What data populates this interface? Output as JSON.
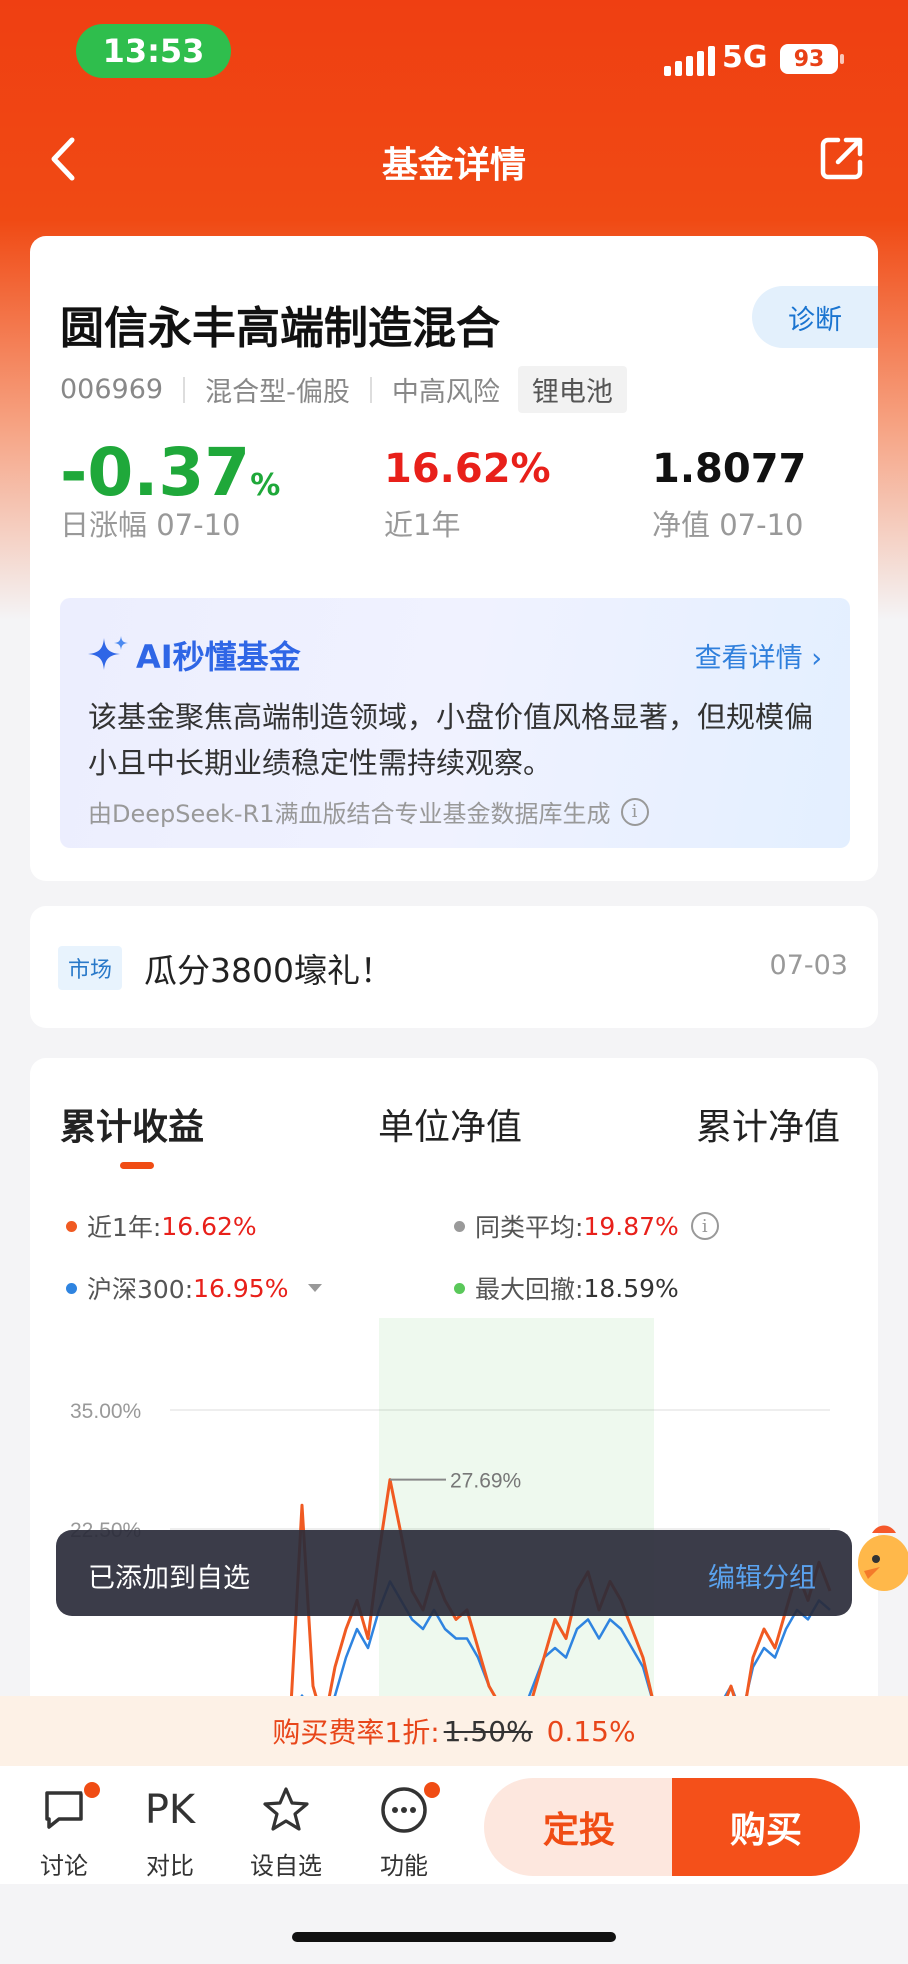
{
  "status_bar": {
    "time": "13:53",
    "network": "5G",
    "battery": "93"
  },
  "nav": {
    "title": "基金详情"
  },
  "fund": {
    "name": "圆信永丰高端制造混合",
    "diagnose_label": "诊断",
    "code": "006969",
    "type": "混合型-偏股",
    "risk": "中高风险",
    "theme_tag": "锂电池",
    "daily_change": {
      "value": "-0.37",
      "unit": "%",
      "label": "日涨幅 07-10"
    },
    "year_return": {
      "value": "16.62%",
      "label": "近1年"
    },
    "nav_value": {
      "value": "1.8077",
      "label": "净值 07-10"
    }
  },
  "ai": {
    "title": "AI秒懂基金",
    "link": "查看详情 ›",
    "summary": "该基金聚焦高端制造领域，小盘价值风格显著，但规模偏小且中长期业绩稳定性需持续观察。",
    "note": "由DeepSeek-R1满血版结合专业基金数据库生成"
  },
  "news": {
    "tag": "市场",
    "text": "瓜分3800壕礼！",
    "date": "07-03"
  },
  "chart_tabs": [
    "累计收益",
    "单位净值",
    "累计净值"
  ],
  "legend": {
    "fund": {
      "label": "近1年:",
      "value": "16.62%"
    },
    "peer": {
      "label": "同类平均:",
      "value": "19.87%"
    },
    "index": {
      "label": "沪深300:",
      "value": "16.95%"
    },
    "drawdown": {
      "label": "最大回撤:",
      "value": "18.59%"
    }
  },
  "colors": {
    "fund": "#f05a22",
    "peer": "#9a9a9a",
    "index": "#2f84e0",
    "drawdown": "#5ac85a",
    "accent": "#f04c14"
  },
  "chart_data": {
    "type": "line",
    "ylabels": [
      "35.00%",
      "22.50%"
    ],
    "peak_annotation": "27.69%",
    "series": [
      {
        "name": "近1年",
        "values": [
          -2,
          0.5,
          -1.5,
          1,
          -3,
          -4,
          -2,
          -3,
          1,
          3,
          -2,
          4,
          25,
          6,
          2,
          8,
          12,
          15,
          11,
          20,
          27.69,
          22,
          16,
          14,
          18,
          15,
          13,
          14,
          10,
          6,
          4,
          3,
          2,
          5,
          9,
          13,
          11,
          16,
          18,
          14,
          17,
          15,
          12,
          9,
          4,
          -2,
          -5,
          -3,
          0,
          -1,
          3,
          6,
          2,
          9,
          12,
          10,
          14,
          18,
          15,
          19,
          16
        ]
      },
      {
        "name": "沪深300",
        "values": [
          -1,
          1,
          -2,
          0.5,
          -2,
          -3,
          -1,
          -2,
          0,
          1,
          -1,
          2,
          5,
          3,
          2,
          5,
          9,
          12,
          10,
          14,
          17,
          15,
          13,
          12,
          14,
          12,
          11,
          11,
          9,
          6,
          4,
          4,
          3,
          6,
          9,
          10,
          9,
          12,
          13,
          11,
          13,
          12,
          10,
          8,
          4,
          0,
          -2,
          -1,
          1,
          1,
          4,
          6,
          3,
          8,
          10,
          9,
          12,
          14,
          13,
          15,
          14
        ]
      }
    ]
  },
  "toast": {
    "message": "已添加到自选",
    "action": "编辑分组"
  },
  "promo": {
    "prefix": "购买费率1折:",
    "old_rate": "1.50%",
    "new_rate": "0.15%"
  },
  "bottom_bar": {
    "discuss": "讨论",
    "compare_icon": "PK",
    "compare": "对比",
    "watchlist": "设自选",
    "functions": "功能",
    "sip": "定投",
    "buy": "购买"
  }
}
